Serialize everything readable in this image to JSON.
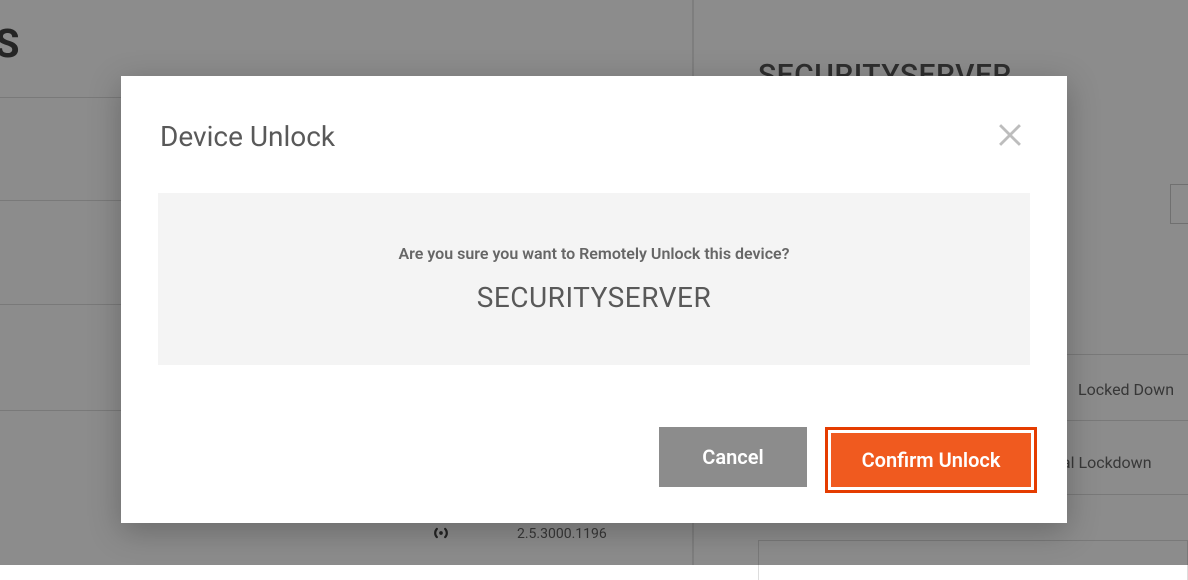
{
  "background": {
    "title_fragment": "ICS",
    "right_title": "SECURITYSERVER",
    "version": "2.5.3000.1196",
    "status1": "Locked Down",
    "status2": "ial Lockdown"
  },
  "modal": {
    "title": "Device Unlock",
    "question": "Are you sure you want to Remotely Unlock this device?",
    "device_name": "SECURITYSERVER",
    "cancel_label": "Cancel",
    "confirm_label": "Confirm Unlock"
  }
}
